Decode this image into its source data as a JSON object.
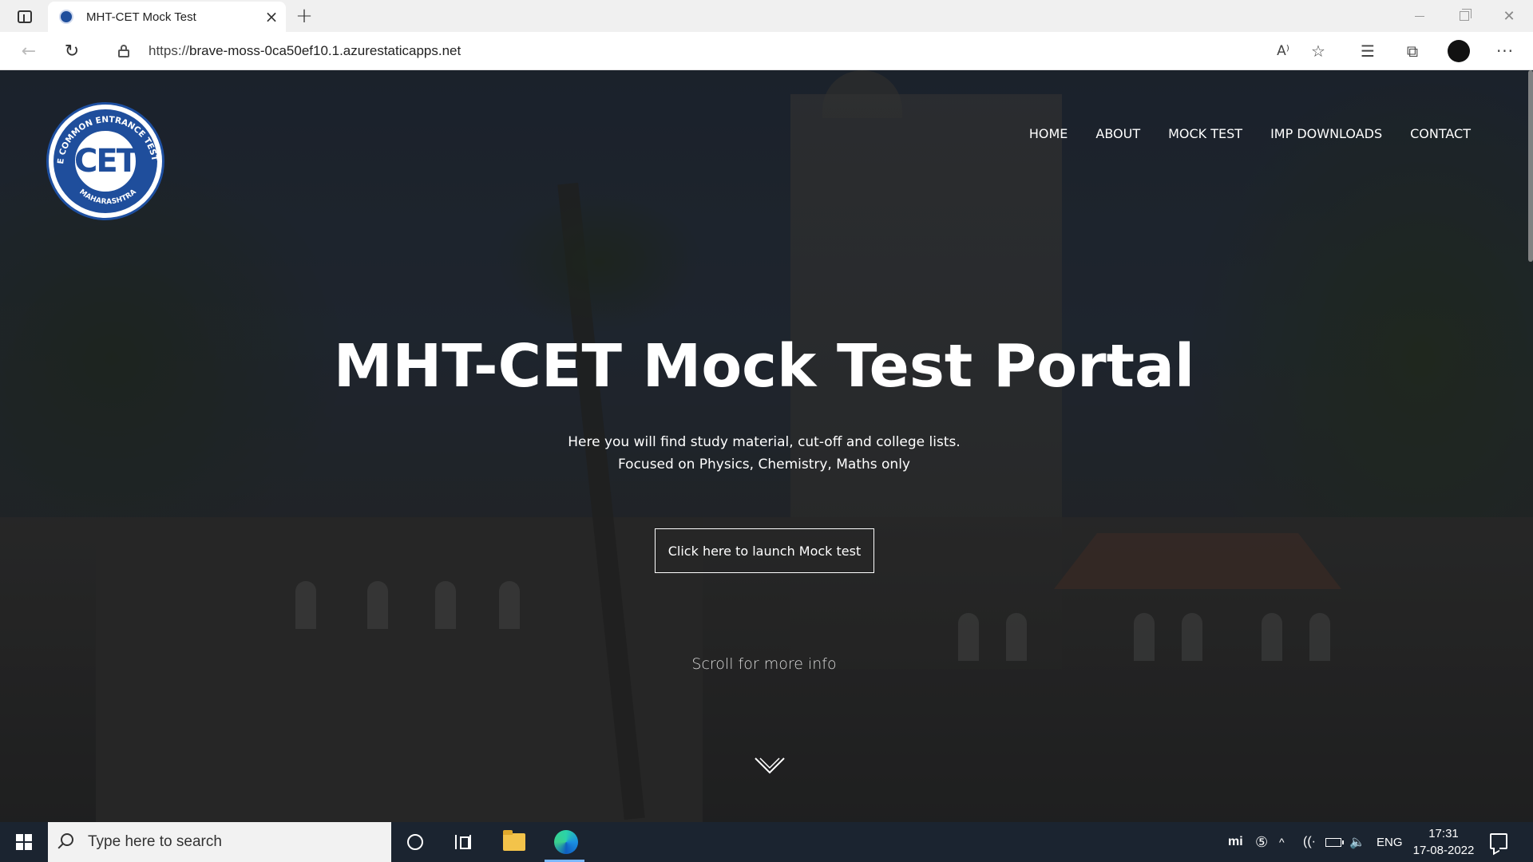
{
  "browser": {
    "tab": {
      "title": "MHT-CET Mock Test",
      "close_glyph": "×",
      "favicon": "cet-logo-icon"
    },
    "new_tab_glyph": "+",
    "window_controls": {
      "close_glyph": "✕"
    },
    "address": {
      "scheme": "https://",
      "host": "brave-moss-0ca50ef10.1.azurestaticapps.net"
    },
    "toolbar_icons": {
      "back": "←",
      "refresh": "↻",
      "read_aloud": "A⁾",
      "add_favorite": "☆",
      "favorites": "☰",
      "collections": "⧉",
      "more": "···"
    }
  },
  "site": {
    "logo": {
      "arc_top": "STATE COMMON ENTRANCE TEST CELL",
      "arc_bottom": "MAHARASHTRA",
      "mark": "CET"
    },
    "nav": [
      {
        "label": "HOME"
      },
      {
        "label": "ABOUT"
      },
      {
        "label": "MOCK TEST"
      },
      {
        "label": "IMP DOWNLOADS"
      },
      {
        "label": "CONTACT"
      }
    ],
    "hero": {
      "title": "MHT-CET Mock Test Portal",
      "subtitle_line1": "Here you will find study material, cut-off and college lists.",
      "subtitle_line2": "Focused on Physics, Chemistry, Maths only",
      "cta_label": "Click here to launch Mock test",
      "scroll_hint": "Scroll for more info"
    }
  },
  "taskbar": {
    "search_placeholder": "Type here to search",
    "tray": {
      "mi": "mi",
      "sync": "⑤",
      "up": "^",
      "wifi": "((·",
      "volume": "🔈",
      "lang": "ENG"
    },
    "clock": {
      "time": "17:31",
      "date": "17-08-2022"
    }
  },
  "colors": {
    "accent_blue": "#1f4e9c",
    "taskbar": "#1b2430",
    "text_white": "#ffffff"
  }
}
